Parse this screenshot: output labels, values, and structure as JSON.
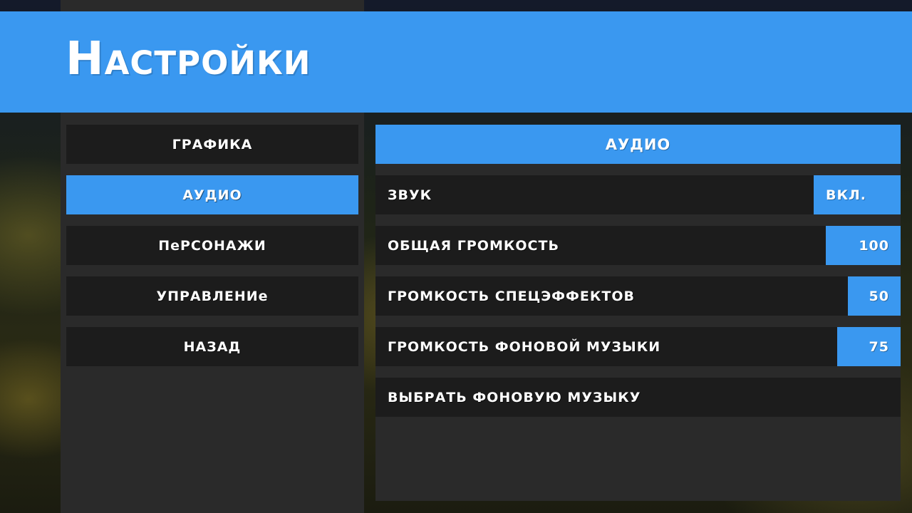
{
  "header": {
    "title": "Настройки"
  },
  "menu": {
    "items": [
      {
        "label": "ГРАФИКА",
        "active": false
      },
      {
        "label": "АУДИО",
        "active": true
      },
      {
        "label": "ПеРСОНАЖИ",
        "active": false
      },
      {
        "label": "УПРАВЛЕНИе",
        "active": false
      },
      {
        "label": "НАЗАД",
        "active": false
      }
    ]
  },
  "audio": {
    "section_title": "АУДИО",
    "settings": [
      {
        "label": "ЗВУК",
        "value": "ВКЛ."
      },
      {
        "label": "ОБЩАЯ ГРОМКОСТЬ",
        "value": "100"
      },
      {
        "label": "ГРОМКОСТЬ СПЕЦЭФФЕКТОВ",
        "value": "50"
      },
      {
        "label": "ГРОМКОСТЬ ФОНОВОЙ МУЗЫКИ",
        "value": "75"
      },
      {
        "label": "ВЫБРАТЬ ФОНОВУЮ МУЗЫКУ",
        "value": ""
      }
    ]
  },
  "colors": {
    "accent": "#3a98f0",
    "panel": "#2a2a2a",
    "row": "#1c1c1c"
  }
}
